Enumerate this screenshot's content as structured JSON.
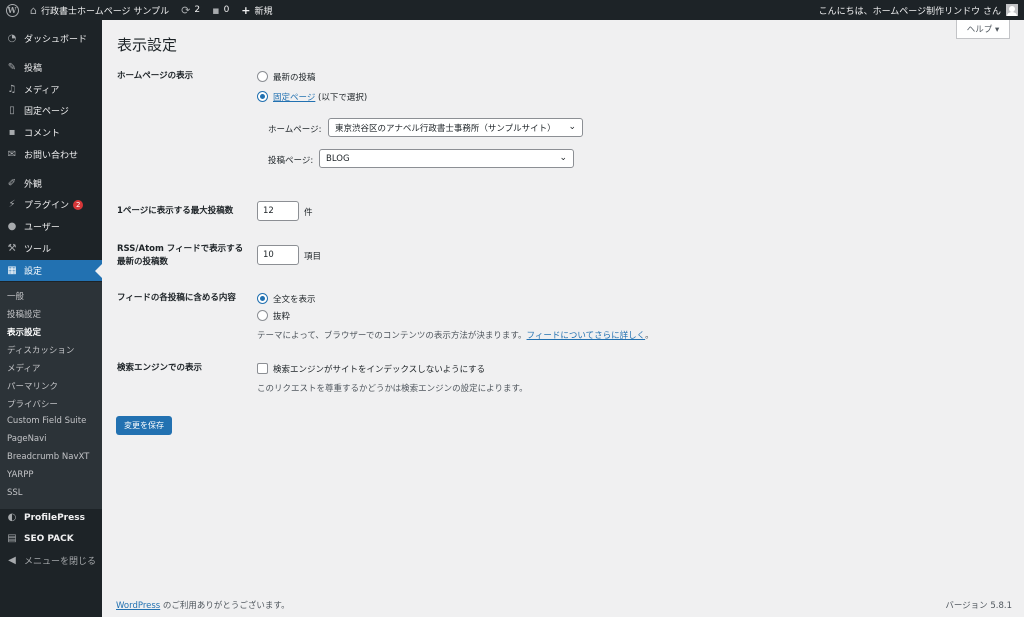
{
  "adminbar": {
    "site_name": "行政書士ホームページ サンプル",
    "updates_count": "2",
    "comments_count": "0",
    "new_label": "新規",
    "greeting": "こんにちは、ホームページ制作リンドウ さん"
  },
  "sidebar": {
    "items": [
      {
        "label": "ダッシュボード",
        "icon": "dashboard-icon"
      },
      {
        "label": "投稿",
        "icon": "pin-icon"
      },
      {
        "label": "メディア",
        "icon": "media-icon"
      },
      {
        "label": "固定ページ",
        "icon": "page-icon"
      },
      {
        "label": "コメント",
        "icon": "comment-icon"
      },
      {
        "label": "お問い合わせ",
        "icon": "mail-icon"
      },
      {
        "label": "外観",
        "icon": "brush-icon"
      },
      {
        "label": "プラグイン",
        "icon": "plugin-icon",
        "badge": "2"
      },
      {
        "label": "ユーザー",
        "icon": "user-icon"
      },
      {
        "label": "ツール",
        "icon": "wrench-icon"
      },
      {
        "label": "設定",
        "icon": "settings-icon"
      }
    ],
    "submenu": [
      "一般",
      "投稿設定",
      "表示設定",
      "ディスカッション",
      "メディア",
      "パーマリンク",
      "プライバシー",
      "Custom Field Suite",
      "PageNavi",
      "Breadcrumb NavXT",
      "YARPP",
      "SSL"
    ],
    "extra": [
      {
        "label": "ProfilePress",
        "icon": "profilepress-icon"
      },
      {
        "label": "SEO PACK",
        "icon": "seo-pack-icon"
      }
    ],
    "collapse_label": "メニューを閉じる"
  },
  "help_tab": "ヘルプ ▾",
  "page_title": "表示設定",
  "homepage_display": {
    "label": "ホームページの表示",
    "option_latest": "最新の投稿",
    "option_static_link": "固定ページ",
    "option_static_suffix": " (以下で選択)",
    "homepage_label": "ホームページ:",
    "homepage_value": "東京渋谷区のアナベル行政書士事務所（サンプルサイト）",
    "posts_page_label": "投稿ページ:",
    "posts_page_value": "BLOG"
  },
  "posts_per_page": {
    "label": "1ページに表示する最大投稿数",
    "value": "12",
    "unit": "件"
  },
  "feed_items": {
    "label_line1": "RSS/Atom フィードで表示する",
    "label_line2": "最新の投稿数",
    "value": "10",
    "unit": "項目"
  },
  "feed_content": {
    "label": "フィードの各投稿に含める内容",
    "option_full": "全文を表示",
    "option_excerpt": "抜粋",
    "desc_prefix": "テーマによって、ブラウザーでのコンテンツの表示方法が決まります。",
    "desc_link": "フィードについてさらに詳しく",
    "desc_suffix": "。"
  },
  "search_visibility": {
    "label": "検索エンジンでの表示",
    "checkbox_label": "検索エンジンがサイトをインデックスしないようにする",
    "desc": "このリクエストを尊重するかどうかは検索エンジンの設定によります。"
  },
  "save_button": "変更を保存",
  "footer": {
    "wp_link": "WordPress",
    "thanks": " のご利用ありがとうございます。",
    "version": "バージョン 5.8.1"
  },
  "colors": {
    "accent": "#2271b1",
    "adminbar_bg": "#1d2327",
    "badge": "#d63638"
  }
}
